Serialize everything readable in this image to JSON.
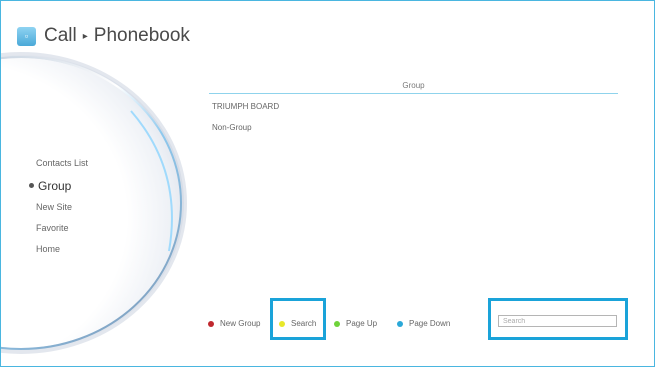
{
  "header": {
    "icon": "phone-app-icon",
    "title": "Call",
    "separator": "▸",
    "subtitle": "Phonebook"
  },
  "sidebar": {
    "items": [
      {
        "label": "Contacts List",
        "active": false
      },
      {
        "label": "Group",
        "active": true
      },
      {
        "label": "New Site",
        "active": false
      },
      {
        "label": "Favorite",
        "active": false
      },
      {
        "label": "Home",
        "active": false
      }
    ]
  },
  "main": {
    "column_header": "Group",
    "rows": [
      "TRIUMPH BOARD",
      "Non-Group"
    ]
  },
  "footer": {
    "legend": [
      {
        "label": "New Group",
        "color": "#c0282e"
      },
      {
        "label": "Search",
        "color": "#e8e82a"
      },
      {
        "label": "Page Up",
        "color": "#6fd33a"
      },
      {
        "label": "Page Down",
        "color": "#2aa8d8"
      }
    ],
    "search_placeholder": "Search"
  },
  "colors": {
    "accent": "#1aa3d9",
    "frame": "#4ab6e0",
    "header_line": "#8fd3ec"
  }
}
